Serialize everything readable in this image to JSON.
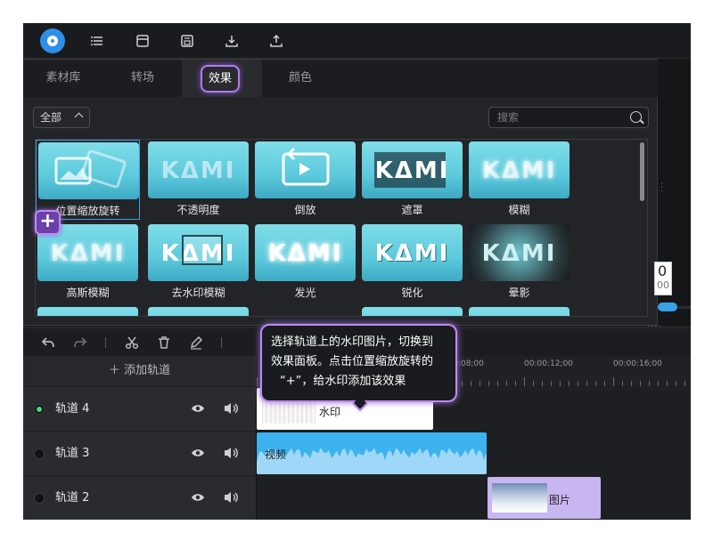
{
  "tabs": [
    "素材库",
    "转场",
    "效果",
    "颜色"
  ],
  "active_tab": "效果",
  "filter": {
    "label": "全部"
  },
  "search": {
    "placeholder": "搜索"
  },
  "effects": [
    {
      "label": "位置缩放旋转",
      "thumb": "image-move"
    },
    {
      "label": "不透明度",
      "thumb": "kami"
    },
    {
      "label": "倒放",
      "thumb": "rewind"
    },
    {
      "label": "遮罩",
      "thumb": "kami-mask"
    },
    {
      "label": "模糊",
      "thumb": "kami-blur"
    },
    {
      "label": "高斯模糊",
      "thumb": "kami-blur"
    },
    {
      "label": "去水印模糊",
      "thumb": "kami-box"
    },
    {
      "label": "发光",
      "thumb": "kami-glow"
    },
    {
      "label": "锐化",
      "thumb": "kami-sharp"
    },
    {
      "label": "晕影",
      "thumb": "kami-vignette"
    }
  ],
  "timeline": {
    "add_track_label": "添加轨道",
    "ruler_labels": [
      "00:00:08;00",
      "00:00:12;00",
      "00:00:16;00"
    ],
    "tracks": [
      {
        "name": "轨道 4",
        "active": true,
        "clip_label": "水印"
      },
      {
        "name": "轨道 3",
        "active": false,
        "clip_label": "视频"
      },
      {
        "name": "轨道 2",
        "active": false,
        "clip_label": "图片"
      }
    ]
  },
  "tooltip": {
    "text_line1": "选择轨道上的水印图片，切换到",
    "text_line2": "效果面板。点击位置缩放旋转的",
    "text_line3": "“+”，给水印添加该效果"
  },
  "preview": {
    "time_top": "0",
    "time_bottom": "00"
  },
  "colors": {
    "accent": "#3aa0e8",
    "highlight": "#c08af0",
    "video_clip": "#3cb2ee",
    "picture_clip": "#c8b6f2"
  }
}
